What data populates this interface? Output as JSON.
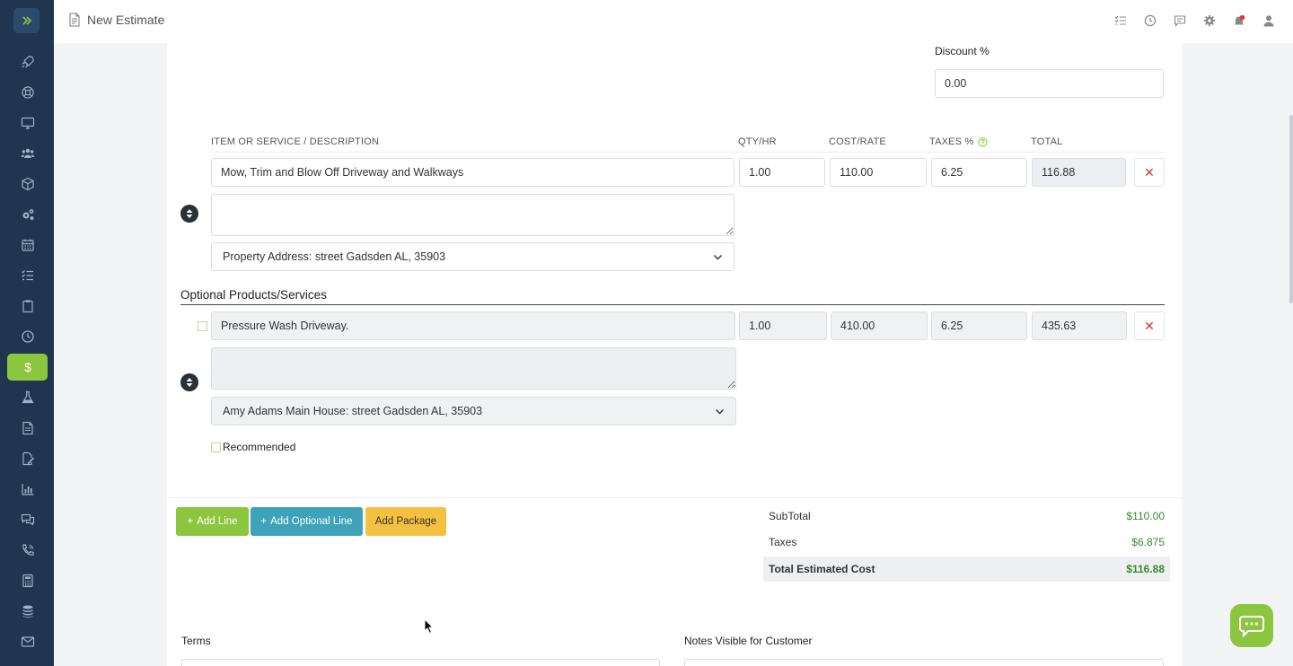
{
  "app": {
    "page_title": "New Estimate",
    "accent": "#8cc63f",
    "sidebar_bg": "#1f3550"
  },
  "header": {
    "icons": [
      "checklist-icon",
      "clock-icon",
      "chat-icon",
      "gear-icon",
      "bell-icon",
      "user-icon"
    ]
  },
  "sidebar": {
    "items": [
      {
        "icon": "rocket-icon"
      },
      {
        "icon": "lifebuoy-icon"
      },
      {
        "icon": "monitor-icon"
      },
      {
        "icon": "users-icon"
      },
      {
        "icon": "cube-icon"
      },
      {
        "icon": "cogs-icon"
      },
      {
        "icon": "calendar-icon"
      },
      {
        "icon": "tasks-icon"
      },
      {
        "icon": "clipboard-icon"
      },
      {
        "icon": "clock-icon"
      },
      {
        "icon": "dollar-icon",
        "active": true
      },
      {
        "icon": "flask-icon"
      },
      {
        "icon": "file-icon"
      },
      {
        "icon": "edit-file-icon"
      },
      {
        "icon": "bar-chart-icon"
      },
      {
        "icon": "comments-icon"
      },
      {
        "icon": "phone-icon"
      },
      {
        "icon": "calculator-icon"
      },
      {
        "icon": "database-icon"
      },
      {
        "icon": "mail-icon"
      }
    ]
  },
  "discount": {
    "label": "Discount %",
    "value": "0.00"
  },
  "columns": {
    "item": "ITEM OR SERVICE / DESCRIPTION",
    "qty": "QTY/HR",
    "cost": "COST/RATE",
    "taxes": "TAXES %",
    "total": "TOTAL"
  },
  "line_items": [
    {
      "item": "Mow, Trim and Blow Off Driveway and Walkways",
      "description": "",
      "qty": "1.00",
      "cost": "110.00",
      "taxes": "6.25",
      "total": "116.88",
      "address": "Property Address: street Gadsden AL, 35903"
    }
  ],
  "optional_section": {
    "title": "Optional Products/Services"
  },
  "optional_items": [
    {
      "item": "Pressure Wash Driveway.",
      "description": "",
      "qty": "1.00",
      "cost": "410.00",
      "taxes": "6.25",
      "total": "435.63",
      "address": "Amy Adams Main House: street Gadsden AL, 35903",
      "recommended_label": "Recommended"
    }
  ],
  "buttons": {
    "add_line": "Add Line",
    "add_optional_line": "Add Optional Line",
    "add_package": "Add Package"
  },
  "totals": {
    "subtotal_label": "SubTotal",
    "subtotal_value": "$110.00",
    "taxes_label": "Taxes",
    "taxes_value": "$6.875",
    "total_label": "Total Estimated Cost",
    "total_value": "$116.88"
  },
  "bottom": {
    "terms_label": "Terms",
    "notes_label": "Notes Visible for Customer"
  }
}
